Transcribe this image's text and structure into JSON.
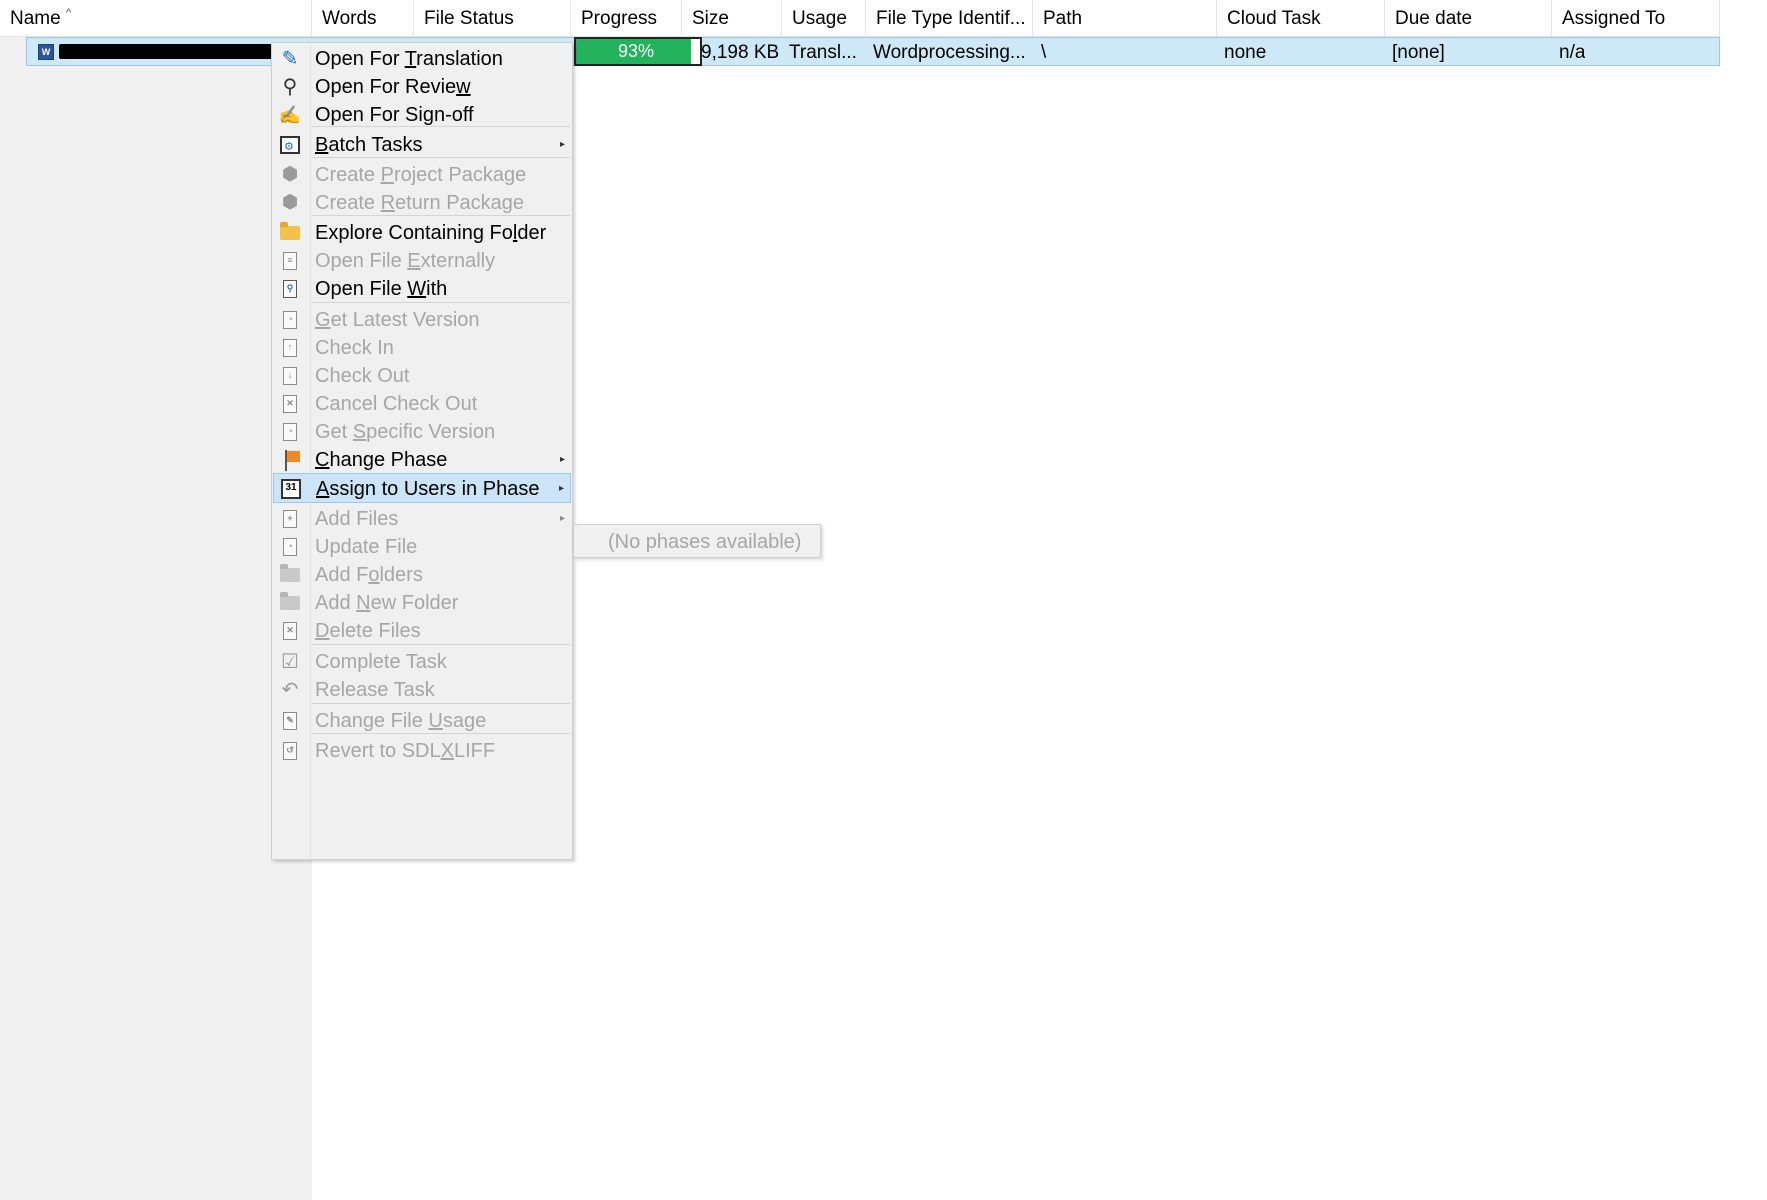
{
  "columns": [
    {
      "key": "name",
      "label": "Name",
      "sorted": "asc"
    },
    {
      "key": "words",
      "label": "Words"
    },
    {
      "key": "file_status",
      "label": "File Status"
    },
    {
      "key": "progress",
      "label": "Progress"
    },
    {
      "key": "size",
      "label": "Size"
    },
    {
      "key": "usage",
      "label": "Usage"
    },
    {
      "key": "file_type",
      "label": "File Type Identif..."
    },
    {
      "key": "path",
      "label": "Path"
    },
    {
      "key": "cloud_task",
      "label": "Cloud Task"
    },
    {
      "key": "due_date",
      "label": "Due date"
    },
    {
      "key": "assigned_to",
      "label": "Assigned To"
    }
  ],
  "sort_indicator": "^",
  "row": {
    "icon": "word-document-icon",
    "icon_letter": "W",
    "progress_label": "93%",
    "progress_value": 0.93,
    "progress_color": "#22b35c",
    "size": "9,198 KB",
    "usage": "Transl...",
    "file_type": "Wordprocessing...",
    "path": "\\",
    "cloud_task": "none",
    "due_date": "[none]",
    "assigned_to": "n/a"
  },
  "menu": {
    "items": [
      {
        "id": "open-for-translation",
        "pre": "Open For ",
        "u": "T",
        "post": "ranslation",
        "enabled": true,
        "icon": "pencil-icon"
      },
      {
        "id": "open-for-review",
        "pre": "Open For Revie",
        "u": "w",
        "post": "",
        "enabled": true,
        "icon": "magnifier-icon"
      },
      {
        "id": "open-for-sign-off",
        "pre": "Open For Sign-off",
        "u": "",
        "post": "",
        "enabled": true,
        "icon": "sign-off-icon"
      },
      {
        "id": "batch-tasks",
        "pre": "",
        "u": "B",
        "post": "atch Tasks",
        "enabled": true,
        "icon": "batch-tasks-icon",
        "submenu": true
      },
      {
        "id": "create-project-package",
        "pre": "Create ",
        "u": "P",
        "post": "roject Package",
        "enabled": false,
        "icon": "package-icon"
      },
      {
        "id": "create-return-package",
        "pre": "Create ",
        "u": "R",
        "post": "eturn Package",
        "enabled": false,
        "icon": "return-package-icon"
      },
      {
        "id": "explore-containing-folder",
        "pre": "Explore Containing Fo",
        "u": "l",
        "post": "der",
        "enabled": true,
        "icon": "folder-icon"
      },
      {
        "id": "open-file-externally",
        "pre": "Open File ",
        "u": "E",
        "post": "xternally",
        "enabled": false,
        "icon": "document-icon"
      },
      {
        "id": "open-file-with",
        "pre": "Open File ",
        "u": "W",
        "post": "ith",
        "enabled": true,
        "icon": "document-search-icon"
      },
      {
        "id": "get-latest-version",
        "pre": "",
        "u": "G",
        "post": "et Latest Version",
        "enabled": false,
        "icon": "latest-version-icon"
      },
      {
        "id": "check-in",
        "pre": "Check In",
        "u": "",
        "post": "",
        "enabled": false,
        "icon": "check-in-icon"
      },
      {
        "id": "check-out",
        "pre": "Check Out",
        "u": "",
        "post": "",
        "enabled": false,
        "icon": "check-out-icon"
      },
      {
        "id": "cancel-check-out",
        "pre": "Cancel Check Out",
        "u": "",
        "post": "",
        "enabled": false,
        "icon": "cancel-check-out-icon"
      },
      {
        "id": "get-specific-version",
        "pre": "Get ",
        "u": "S",
        "post": "pecific Version",
        "enabled": false,
        "icon": "specific-version-icon"
      },
      {
        "id": "change-phase",
        "pre": "",
        "u": "C",
        "post": "hange Phase",
        "enabled": true,
        "icon": "flag-icon",
        "submenu": true
      },
      {
        "id": "assign-to-users-in-phase",
        "pre": "",
        "u": "A",
        "post": "ssign to Users in Phase",
        "enabled": true,
        "icon": "calendar-icon",
        "submenu": true,
        "hover": true
      },
      {
        "id": "add-files",
        "pre": "Add Files",
        "u": "",
        "post": "",
        "enabled": false,
        "icon": "add-files-icon",
        "submenu": true
      },
      {
        "id": "update-file",
        "pre": "Update File",
        "u": "",
        "post": "",
        "enabled": false,
        "icon": "update-file-icon"
      },
      {
        "id": "add-folders",
        "pre": "Add F",
        "u": "o",
        "post": "lders",
        "enabled": false,
        "icon": "add-folders-icon"
      },
      {
        "id": "add-new-folder",
        "pre": "Add ",
        "u": "N",
        "post": "ew Folder",
        "enabled": false,
        "icon": "new-folder-icon"
      },
      {
        "id": "delete-files",
        "pre": "",
        "u": "D",
        "post": "elete Files",
        "enabled": false,
        "icon": "delete-files-icon"
      },
      {
        "id": "complete-task",
        "pre": "Complete Task",
        "u": "",
        "post": "",
        "enabled": false,
        "icon": "checkbox-icon"
      },
      {
        "id": "release-task",
        "pre": "Release Task",
        "u": "",
        "post": "",
        "enabled": false,
        "icon": "release-icon"
      },
      {
        "id": "change-file-usage",
        "pre": "Change File ",
        "u": "U",
        "post": "sage",
        "enabled": false,
        "icon": "file-usage-icon"
      },
      {
        "id": "revert-to-sdlxliff",
        "pre": "Revert to SDL",
        "u": "X",
        "post": "LIFF",
        "enabled": false,
        "icon": "revert-icon"
      }
    ]
  },
  "submenu": {
    "label": "(No phases available)"
  }
}
